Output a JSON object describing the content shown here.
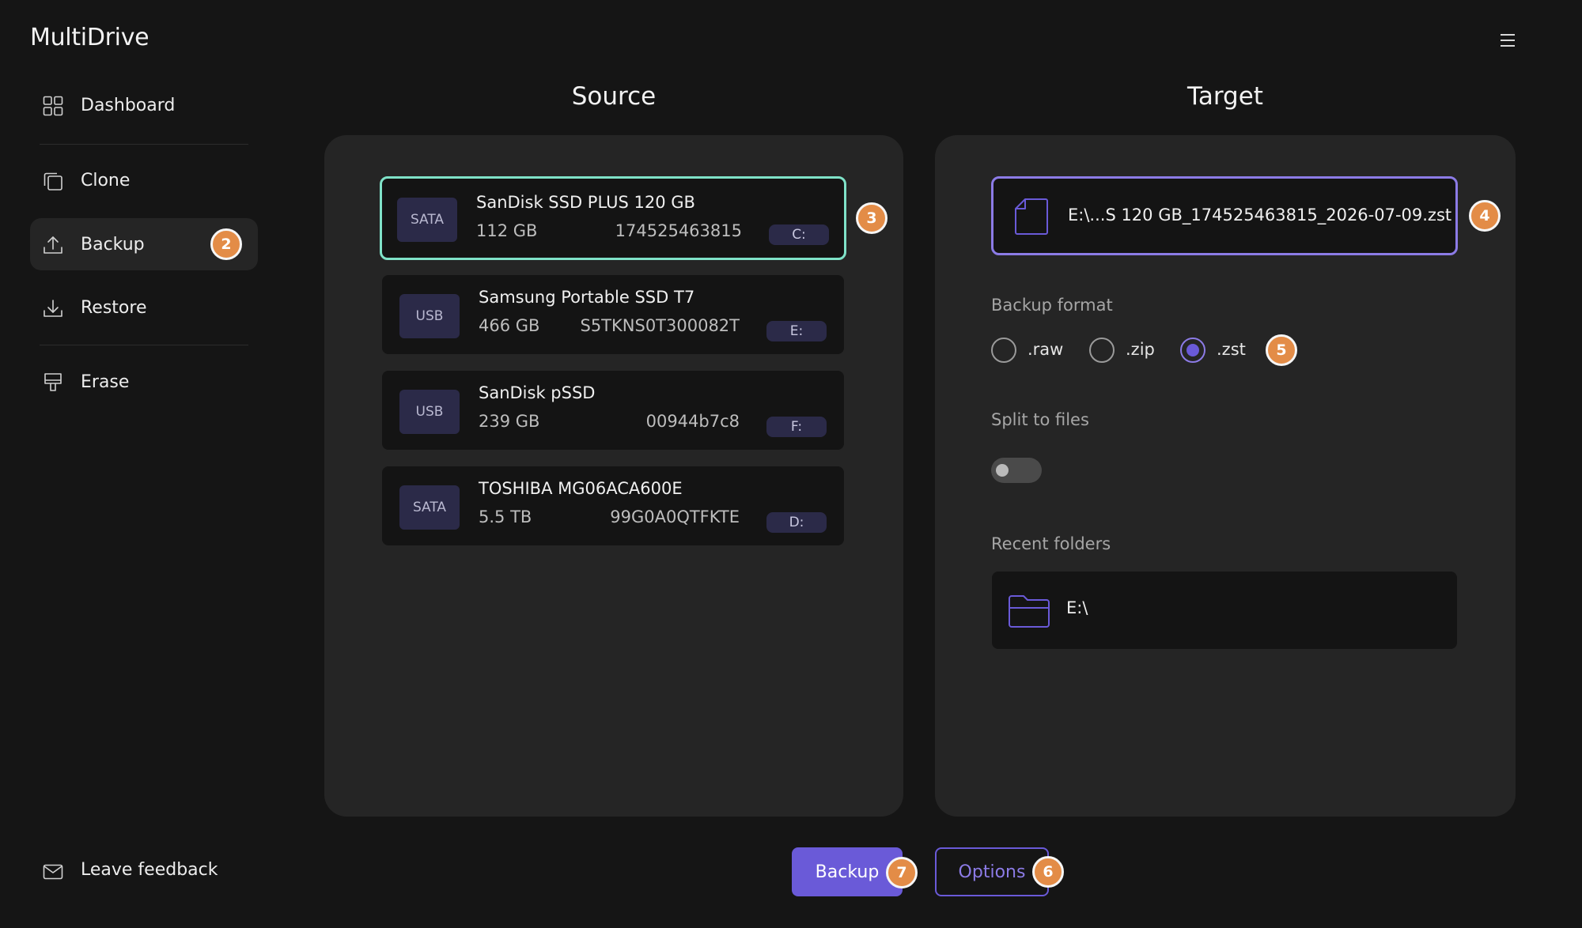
{
  "app": {
    "title": "MultiDrive"
  },
  "sidebar": {
    "items": [
      {
        "label": "Dashboard",
        "icon": "dashboard-icon"
      },
      {
        "label": "Clone",
        "icon": "clone-icon"
      },
      {
        "label": "Backup",
        "icon": "upload-icon",
        "active": true,
        "badge": "2"
      },
      {
        "label": "Restore",
        "icon": "download-icon"
      },
      {
        "label": "Erase",
        "icon": "eraser-icon"
      }
    ],
    "feedback_label": "Leave feedback"
  },
  "source": {
    "title": "Source",
    "badge": "3",
    "drives": [
      {
        "type": "SATA",
        "name": "SanDisk SSD PLUS 120 GB",
        "size": "112 GB",
        "serial": "174525463815",
        "letter": "C:",
        "selected": true
      },
      {
        "type": "USB",
        "name": "Samsung Portable SSD T7",
        "size": "466 GB",
        "serial": "S5TKNS0T300082T",
        "letter": "E:"
      },
      {
        "type": "USB",
        "name": "SanDisk pSSD",
        "size": "239 GB",
        "serial": "00944b7c8",
        "letter": "F:"
      },
      {
        "type": "SATA",
        "name": "TOSHIBA MG06ACA600E",
        "size": "5.5 TB",
        "serial": "99G0A0QTFKTE",
        "letter": "D:"
      }
    ]
  },
  "target": {
    "title": "Target",
    "file_path": "E:\\...S 120 GB_174525463815_2026-07-09.zst",
    "file_badge": "4",
    "format_label": "Backup format",
    "formats": [
      {
        "label": ".raw",
        "checked": false
      },
      {
        "label": ".zip",
        "checked": false
      },
      {
        "label": ".zst",
        "checked": true
      }
    ],
    "format_badge": "5",
    "split_label": "Split to files",
    "split_enabled": false,
    "recent_label": "Recent folders",
    "recent_folders": [
      {
        "path": "E:\\"
      }
    ]
  },
  "actions": {
    "backup_label": "Backup",
    "backup_badge": "7",
    "options_label": "Options",
    "options_badge": "6"
  },
  "colors": {
    "background": "#151515",
    "panel": "#252525",
    "accent": "#6A5AD8",
    "selected_border": "#7FE2C8",
    "badge": "#E38C47"
  }
}
